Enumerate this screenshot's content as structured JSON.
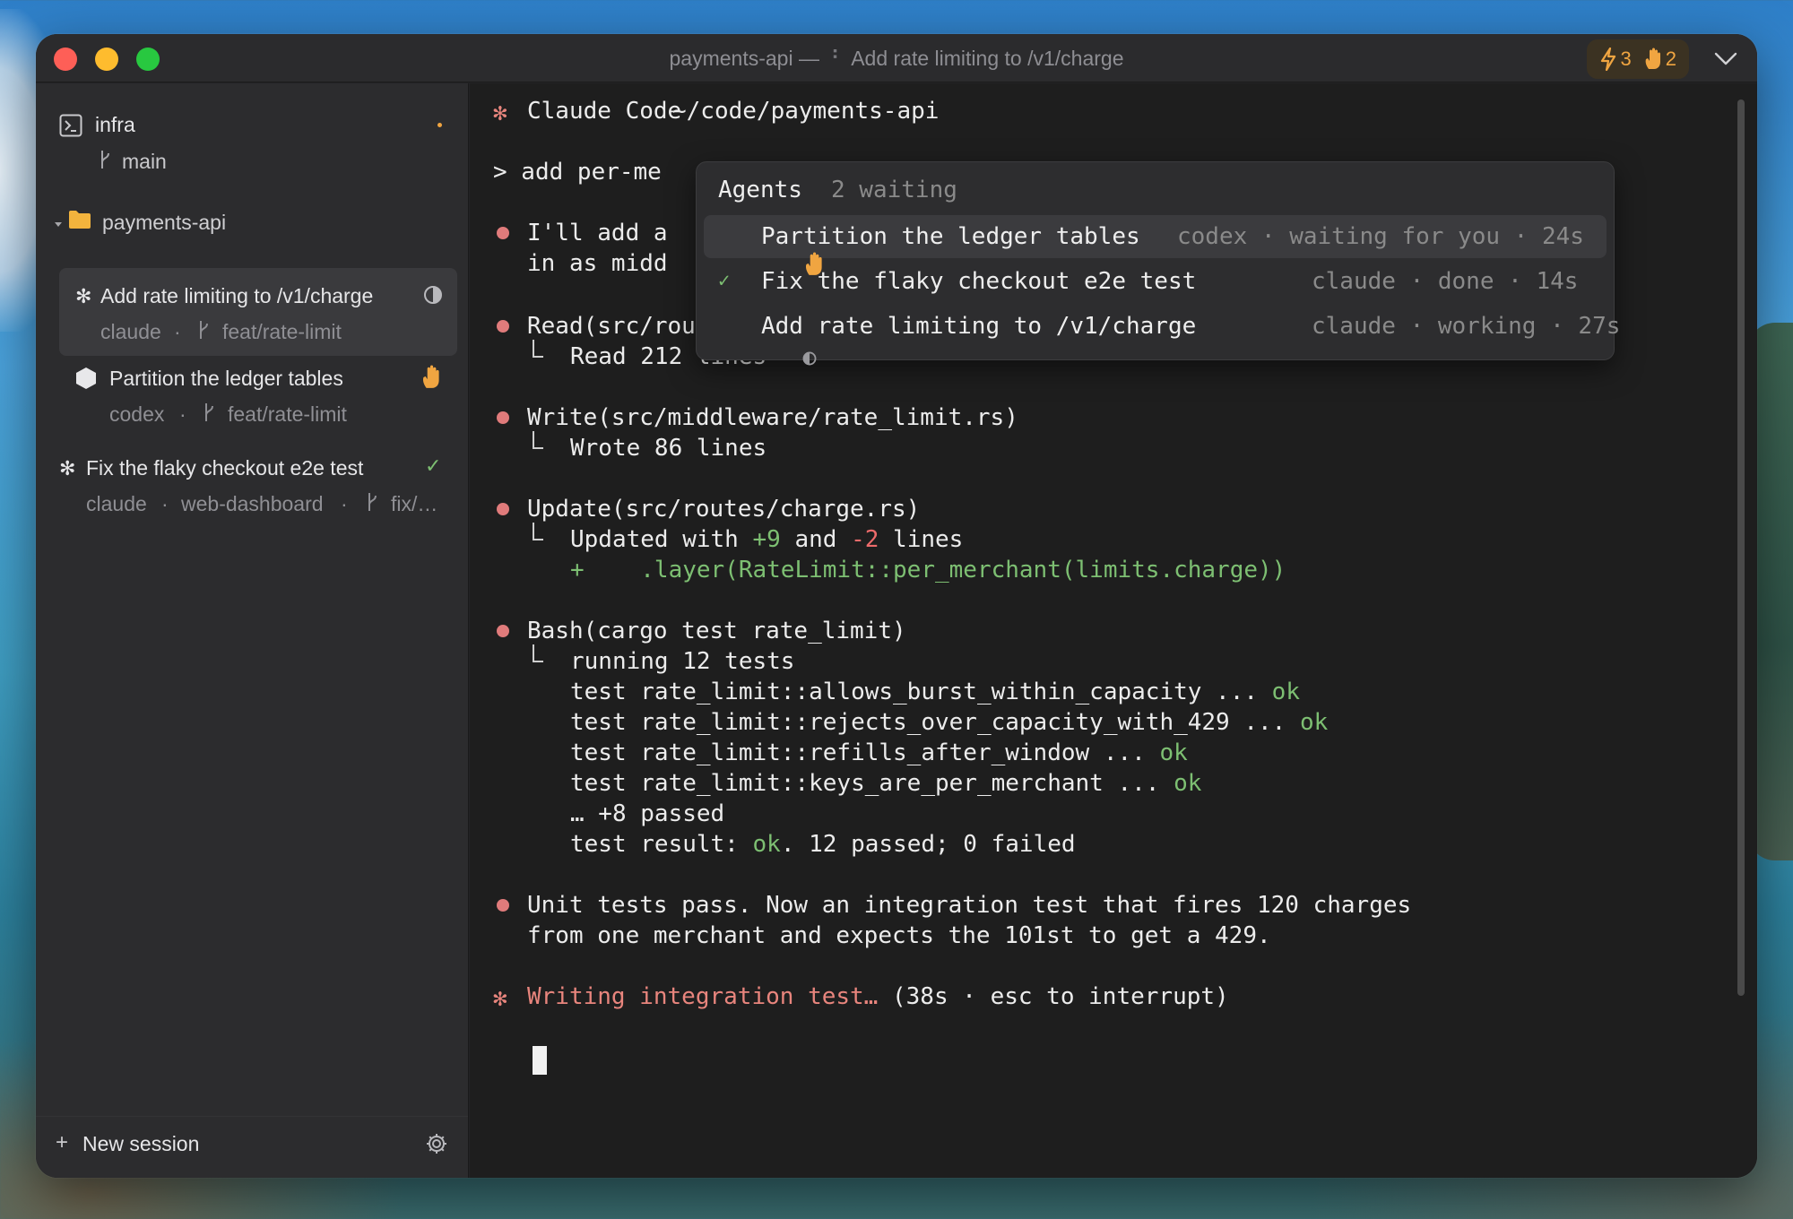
{
  "window": {
    "title_project": "payments-api",
    "title_dash": "—",
    "title_session": "Add rate limiting to /v1/charge",
    "badge_bolt_count": "3",
    "badge_hand_count": "2"
  },
  "sidebar": {
    "groups": [
      {
        "name": "infra",
        "branch": "main"
      },
      {
        "name": "payments-api"
      }
    ],
    "sessions": [
      {
        "title": "Add rate limiting to /v1/charge",
        "agent": "claude",
        "branch": "feat/rate-limit",
        "status": "working",
        "selected": true
      },
      {
        "title": "Partition the ledger tables",
        "agent": "codex",
        "branch": "feat/rate-limit",
        "status": "waiting"
      },
      {
        "title": "Fix the flaky checkout e2e test",
        "agent": "claude",
        "workspace": "web-dashboard",
        "branch": "fix/…",
        "status": "done"
      }
    ],
    "separator": "·",
    "new_session_label": "New session"
  },
  "terminal": {
    "header_app": "Claude Code",
    "header_path": "~/code/payments-api",
    "prompt": "> add per-me",
    "reply_line1": "I'll add a",
    "reply_line2": "in as midd",
    "read_call": "Read(src/routes/charge.rs)",
    "read_result": "Read 212 lines",
    "write_call": "Write(src/middleware/rate_limit.rs)",
    "write_result": "Wrote 86 lines",
    "update_call": "Update(src/routes/charge.rs)",
    "update_pre": "Updated with ",
    "update_plus": "+9",
    "update_mid": " and ",
    "update_minus": "-2",
    "update_post": " lines",
    "diff_line": "+    .layer(RateLimit::per_merchant(limits.charge))",
    "bash_call": "Bash(cargo test rate_limit)",
    "bash_running": "running 12 tests",
    "tests": [
      {
        "name": "test rate_limit::allows_burst_within_capacity ... ",
        "result": "ok"
      },
      {
        "name": "test rate_limit::rejects_over_capacity_with_429 ... ",
        "result": "ok"
      },
      {
        "name": "test rate_limit::refills_after_window ... ",
        "result": "ok"
      },
      {
        "name": "test rate_limit::keys_are_per_merchant ... ",
        "result": "ok"
      }
    ],
    "more_passed": "… +8 passed",
    "result_pre": "test result: ",
    "result_ok": "ok",
    "result_post": ". 12 passed; 0 failed",
    "summary_line1": "Unit tests pass. Now an integration test that fires 120 charges",
    "summary_line2": "from one merchant and expects the 101st to get a 429.",
    "status_action": "Writing integration test…",
    "status_hint": " (38s · esc to interrupt)"
  },
  "agents_popover": {
    "title": "Agents",
    "subtitle": "2 waiting",
    "items": [
      {
        "name": "Partition the ledger tables",
        "meta": "codex · waiting for you · 24s",
        "status": "waiting"
      },
      {
        "name": "Fix the flaky checkout e2e test",
        "meta": "claude · done · 14s",
        "status": "done"
      },
      {
        "name": "Add rate limiting to /v1/charge",
        "meta": "claude · working · 27s",
        "status": "working"
      }
    ]
  },
  "colors": {
    "accent_orange": "#f0a541",
    "bullet": "#e07b7b",
    "ok_green": "#7dbf72",
    "minus_red": "#ee6b6b",
    "traffic_red": "#fe5f57",
    "traffic_yellow": "#febc2e",
    "traffic_green": "#28c840"
  },
  "icons": [
    "terminal-icon",
    "branch-icon",
    "folder-icon",
    "asterisk-icon",
    "half-circle-icon",
    "hexagon-icon",
    "hand-icon",
    "check-icon",
    "bolt-icon",
    "chevron-down-icon",
    "plus-icon",
    "gear-icon"
  ]
}
